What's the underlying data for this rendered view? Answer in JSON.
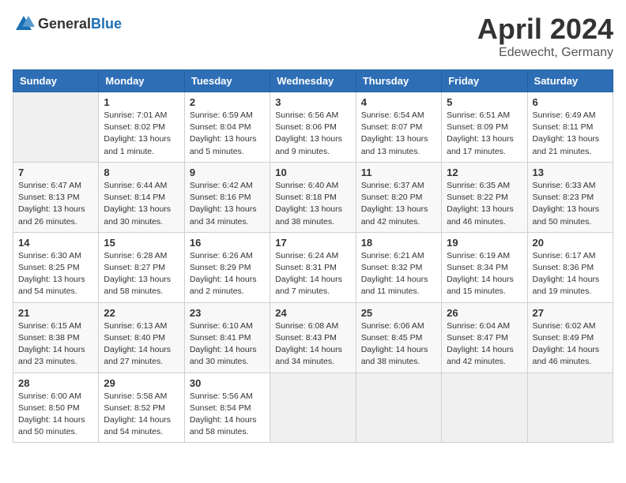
{
  "header": {
    "logo_general": "General",
    "logo_blue": "Blue",
    "month": "April 2024",
    "location": "Edewecht, Germany"
  },
  "weekdays": [
    "Sunday",
    "Monday",
    "Tuesday",
    "Wednesday",
    "Thursday",
    "Friday",
    "Saturday"
  ],
  "weeks": [
    [
      {
        "day": "",
        "info": ""
      },
      {
        "day": "1",
        "info": "Sunrise: 7:01 AM\nSunset: 8:02 PM\nDaylight: 13 hours\nand 1 minute."
      },
      {
        "day": "2",
        "info": "Sunrise: 6:59 AM\nSunset: 8:04 PM\nDaylight: 13 hours\nand 5 minutes."
      },
      {
        "day": "3",
        "info": "Sunrise: 6:56 AM\nSunset: 8:06 PM\nDaylight: 13 hours\nand 9 minutes."
      },
      {
        "day": "4",
        "info": "Sunrise: 6:54 AM\nSunset: 8:07 PM\nDaylight: 13 hours\nand 13 minutes."
      },
      {
        "day": "5",
        "info": "Sunrise: 6:51 AM\nSunset: 8:09 PM\nDaylight: 13 hours\nand 17 minutes."
      },
      {
        "day": "6",
        "info": "Sunrise: 6:49 AM\nSunset: 8:11 PM\nDaylight: 13 hours\nand 21 minutes."
      }
    ],
    [
      {
        "day": "7",
        "info": "Sunrise: 6:47 AM\nSunset: 8:13 PM\nDaylight: 13 hours\nand 26 minutes."
      },
      {
        "day": "8",
        "info": "Sunrise: 6:44 AM\nSunset: 8:14 PM\nDaylight: 13 hours\nand 30 minutes."
      },
      {
        "day": "9",
        "info": "Sunrise: 6:42 AM\nSunset: 8:16 PM\nDaylight: 13 hours\nand 34 minutes."
      },
      {
        "day": "10",
        "info": "Sunrise: 6:40 AM\nSunset: 8:18 PM\nDaylight: 13 hours\nand 38 minutes."
      },
      {
        "day": "11",
        "info": "Sunrise: 6:37 AM\nSunset: 8:20 PM\nDaylight: 13 hours\nand 42 minutes."
      },
      {
        "day": "12",
        "info": "Sunrise: 6:35 AM\nSunset: 8:22 PM\nDaylight: 13 hours\nand 46 minutes."
      },
      {
        "day": "13",
        "info": "Sunrise: 6:33 AM\nSunset: 8:23 PM\nDaylight: 13 hours\nand 50 minutes."
      }
    ],
    [
      {
        "day": "14",
        "info": "Sunrise: 6:30 AM\nSunset: 8:25 PM\nDaylight: 13 hours\nand 54 minutes."
      },
      {
        "day": "15",
        "info": "Sunrise: 6:28 AM\nSunset: 8:27 PM\nDaylight: 13 hours\nand 58 minutes."
      },
      {
        "day": "16",
        "info": "Sunrise: 6:26 AM\nSunset: 8:29 PM\nDaylight: 14 hours\nand 2 minutes."
      },
      {
        "day": "17",
        "info": "Sunrise: 6:24 AM\nSunset: 8:31 PM\nDaylight: 14 hours\nand 7 minutes."
      },
      {
        "day": "18",
        "info": "Sunrise: 6:21 AM\nSunset: 8:32 PM\nDaylight: 14 hours\nand 11 minutes."
      },
      {
        "day": "19",
        "info": "Sunrise: 6:19 AM\nSunset: 8:34 PM\nDaylight: 14 hours\nand 15 minutes."
      },
      {
        "day": "20",
        "info": "Sunrise: 6:17 AM\nSunset: 8:36 PM\nDaylight: 14 hours\nand 19 minutes."
      }
    ],
    [
      {
        "day": "21",
        "info": "Sunrise: 6:15 AM\nSunset: 8:38 PM\nDaylight: 14 hours\nand 23 minutes."
      },
      {
        "day": "22",
        "info": "Sunrise: 6:13 AM\nSunset: 8:40 PM\nDaylight: 14 hours\nand 27 minutes."
      },
      {
        "day": "23",
        "info": "Sunrise: 6:10 AM\nSunset: 8:41 PM\nDaylight: 14 hours\nand 30 minutes."
      },
      {
        "day": "24",
        "info": "Sunrise: 6:08 AM\nSunset: 8:43 PM\nDaylight: 14 hours\nand 34 minutes."
      },
      {
        "day": "25",
        "info": "Sunrise: 6:06 AM\nSunset: 8:45 PM\nDaylight: 14 hours\nand 38 minutes."
      },
      {
        "day": "26",
        "info": "Sunrise: 6:04 AM\nSunset: 8:47 PM\nDaylight: 14 hours\nand 42 minutes."
      },
      {
        "day": "27",
        "info": "Sunrise: 6:02 AM\nSunset: 8:49 PM\nDaylight: 14 hours\nand 46 minutes."
      }
    ],
    [
      {
        "day": "28",
        "info": "Sunrise: 6:00 AM\nSunset: 8:50 PM\nDaylight: 14 hours\nand 50 minutes."
      },
      {
        "day": "29",
        "info": "Sunrise: 5:58 AM\nSunset: 8:52 PM\nDaylight: 14 hours\nand 54 minutes."
      },
      {
        "day": "30",
        "info": "Sunrise: 5:56 AM\nSunset: 8:54 PM\nDaylight: 14 hours\nand 58 minutes."
      },
      {
        "day": "",
        "info": ""
      },
      {
        "day": "",
        "info": ""
      },
      {
        "day": "",
        "info": ""
      },
      {
        "day": "",
        "info": ""
      }
    ]
  ]
}
